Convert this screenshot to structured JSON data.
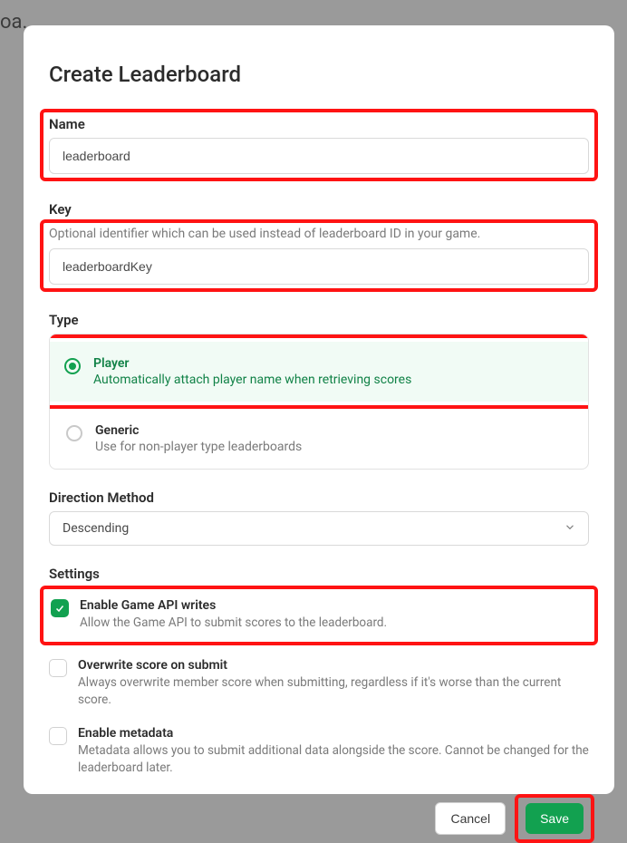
{
  "bg_fragment": "oa...",
  "modal": {
    "title": "Create Leaderboard",
    "name": {
      "label": "Name",
      "value": "leaderboard"
    },
    "key": {
      "label": "Key",
      "hint": "Optional identifier which can be used instead of leaderboard ID in your game.",
      "value": "leaderboardKey"
    },
    "type": {
      "label": "Type",
      "options": [
        {
          "title": "Player",
          "desc": "Automatically attach player name when retrieving scores",
          "selected": true
        },
        {
          "title": "Generic",
          "desc": "Use for non-player type leaderboards",
          "selected": false
        }
      ]
    },
    "direction": {
      "label": "Direction Method",
      "value": "Descending"
    },
    "settings": {
      "label": "Settings",
      "items": [
        {
          "title": "Enable Game API writes",
          "desc": "Allow the Game API to submit scores to the leaderboard.",
          "checked": true
        },
        {
          "title": "Overwrite score on submit",
          "desc": "Always overwrite member score when submitting, regardless if it's worse than the current score.",
          "checked": false
        },
        {
          "title": "Enable metadata",
          "desc": "Metadata allows you to submit additional data alongside the score. Cannot be changed for the leaderboard later.",
          "checked": false
        }
      ]
    },
    "buttons": {
      "cancel": "Cancel",
      "save": "Save"
    }
  }
}
